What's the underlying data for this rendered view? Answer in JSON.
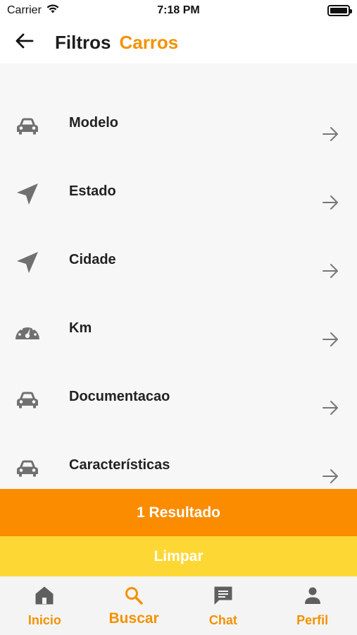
{
  "status_bar": {
    "carrier": "Carrier",
    "time": "7:18 PM",
    "wifi_icon": "wifi-icon",
    "battery_icon": "battery-icon"
  },
  "header": {
    "back_icon": "arrow-left-icon",
    "title": "Filtros",
    "subtitle": "Carros"
  },
  "filters": [
    {
      "label": "Modelo",
      "icon": "car-icon"
    },
    {
      "label": "Estado",
      "icon": "navigation-icon"
    },
    {
      "label": "Cidade",
      "icon": "navigation-icon"
    },
    {
      "label": "Km",
      "icon": "speedometer-icon"
    },
    {
      "label": "Documentacao",
      "icon": "car-icon"
    },
    {
      "label": "Características",
      "icon": "car-icon"
    }
  ],
  "filter_arrow_icon": "arrow-right-icon",
  "actions": {
    "results_label": "1 Resultado",
    "clear_label": "Limpar"
  },
  "bottom_nav": {
    "items": [
      {
        "label": "Inicio",
        "icon": "home-icon",
        "active": false
      },
      {
        "label": "Buscar",
        "icon": "search-icon",
        "active": true
      },
      {
        "label": "Chat",
        "icon": "chat-icon",
        "active": false
      },
      {
        "label": "Perfil",
        "icon": "person-icon",
        "active": false
      }
    ]
  },
  "colors": {
    "accent": "#f39200",
    "results_button": "#fb8c00",
    "clear_button": "#fdd835",
    "icon_gray": "#707070",
    "nav_icon_gray": "#5f5f5f"
  }
}
